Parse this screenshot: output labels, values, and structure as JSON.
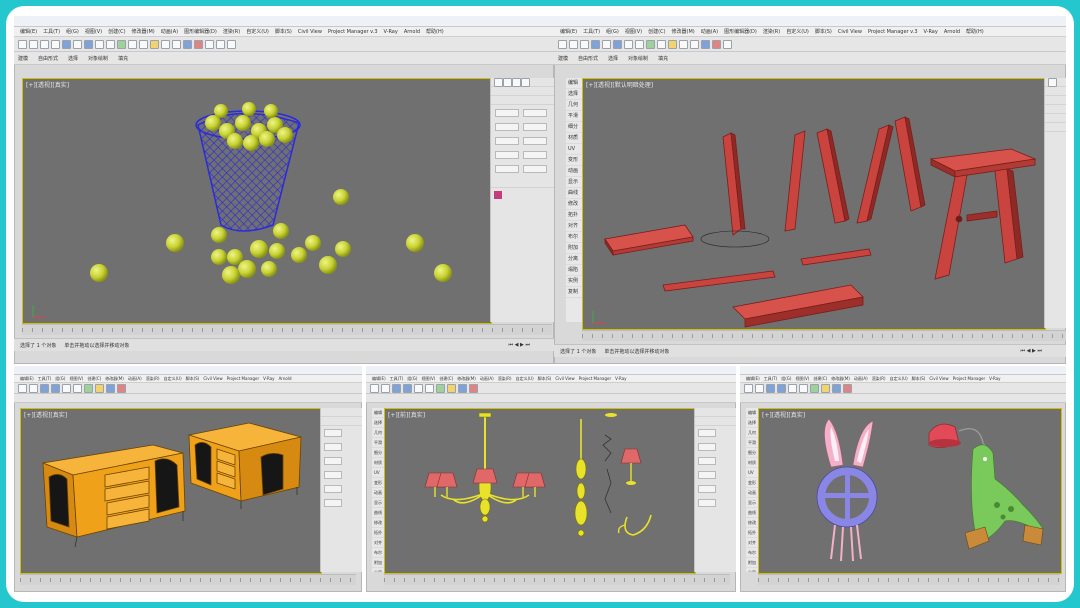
{
  "windows": [
    {
      "id": "w1",
      "title": "",
      "menus": [
        "编辑(E)",
        "工具(T)",
        "组(G)",
        "视图(V)",
        "创建(C)",
        "修改器(M)",
        "动画(A)",
        "图形编辑器(D)",
        "渲染(R)",
        "自定义(U)",
        "脚本(S)",
        "Civil View",
        "Project Manager v.3",
        "V-Ray",
        "Arnold",
        "帮助(H)"
      ],
      "ribbon_tabs": [
        "建模",
        "自由形式",
        "选择",
        "对象绘制",
        "填充"
      ],
      "viewport_label": "[+][透视][真实]",
      "statusbar": [
        "选择了 1 个对象",
        "单击并拖动以选择并移动对象"
      ]
    },
    {
      "id": "w2",
      "title": "",
      "menus": [
        "编辑(E)",
        "工具(T)",
        "组(G)",
        "视图(V)",
        "创建(C)",
        "修改器(M)",
        "动画(A)",
        "图形编辑器(D)",
        "渲染(R)",
        "自定义(U)",
        "脚本(S)",
        "Civil View",
        "Project Manager v.3",
        "V-Ray",
        "Arnold",
        "帮助(H)"
      ],
      "ribbon_tabs": [
        "建模",
        "自由形式",
        "选择",
        "对象绘制",
        "填充"
      ],
      "viewport_label": "[+][透视][默认明暗处理]",
      "left_panel": [
        "编辑",
        "选择",
        "几何",
        "平滑",
        "细分",
        "材质",
        "UV",
        "变形",
        "动画",
        "显示",
        "曲线",
        "修改",
        "拓扑",
        "对齐",
        "布尔",
        "附加",
        "分离",
        "塌陷",
        "实例",
        "复制"
      ],
      "statusbar": [
        "选择了 1 个对象",
        "单击并拖动以选择并移动对象"
      ]
    },
    {
      "id": "w3",
      "title": "",
      "menus": [
        "编辑(E)",
        "工具(T)",
        "组(G)",
        "视图(V)",
        "创建(C)",
        "修改器(M)",
        "动画(A)",
        "渲染(R)",
        "自定义(U)",
        "脚本(S)",
        "Civil View",
        "Project Manager",
        "V-Ray",
        "Arnold"
      ],
      "viewport_label": "[+][透视][真实]"
    },
    {
      "id": "w4",
      "title": "",
      "menus": [
        "编辑(E)",
        "工具(T)",
        "组(G)",
        "视图(V)",
        "创建(C)",
        "修改器(M)",
        "动画(A)",
        "渲染(R)",
        "自定义(U)",
        "脚本(S)",
        "Civil View",
        "Project Manager",
        "V-Ray"
      ],
      "viewport_label": "[+][前][真实]",
      "left_panel": [
        "编辑",
        "选择",
        "几何",
        "平滑",
        "细分",
        "材质",
        "UV",
        "变形",
        "动画",
        "显示",
        "曲线",
        "修改",
        "拓扑",
        "对齐",
        "布尔",
        "附加",
        "分离"
      ]
    },
    {
      "id": "w5",
      "title": "",
      "menus": [
        "编辑(E)",
        "工具(T)",
        "组(G)",
        "视图(V)",
        "创建(C)",
        "修改器(M)",
        "动画(A)",
        "渲染(R)",
        "自定义(U)",
        "脚本(S)",
        "Civil View",
        "Project Manager",
        "V-Ray"
      ],
      "viewport_label": "[+][透视][真实]",
      "left_panel": [
        "编辑",
        "选择",
        "几何",
        "平滑",
        "细分",
        "材质",
        "UV",
        "变形",
        "动画",
        "显示",
        "曲线",
        "修改",
        "拓扑",
        "对齐",
        "布尔",
        "附加",
        "分离"
      ]
    }
  ],
  "colors": {
    "frame_bg": "#25c7cf",
    "viewport_bg": "#707070",
    "viewport_border": "#d2c100",
    "ball": "#c8d232",
    "basket": "#2b2bdc",
    "wood_red": "#c9443f",
    "cabinet_yellow": "#f0a11a",
    "lamp_yellow": "#e8e22a",
    "lamp_shade": "#e06868",
    "rabbit_pink": "#f4b0c9",
    "ring_purple": "#8a86e6",
    "dino_green": "#79c95b"
  }
}
